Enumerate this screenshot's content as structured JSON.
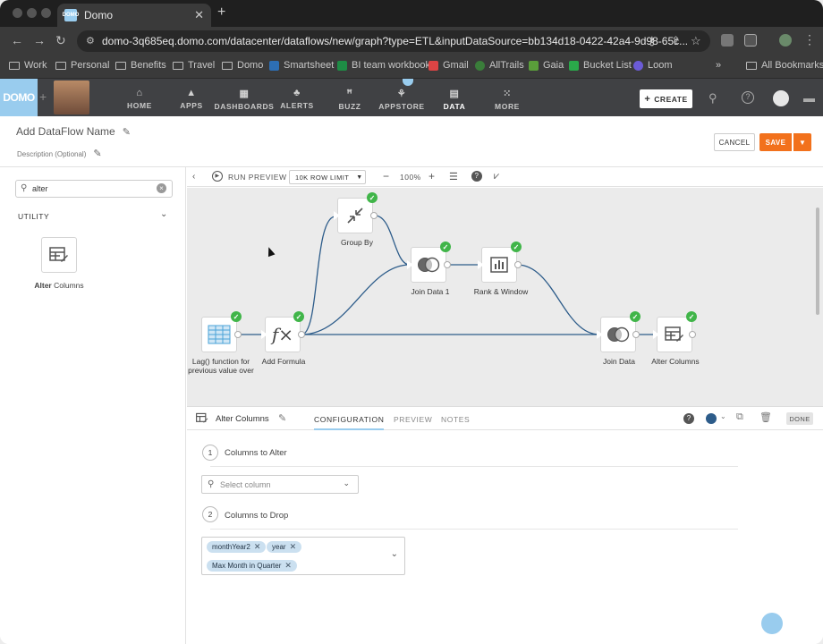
{
  "browser": {
    "tab_title": "Domo",
    "url": "domo-3q685eq.domo.com/datacenter/dataflows/new/graph?type=ETL&inputDataSource=bb134d18-0422-42a4-9d98-65c...",
    "bookmarks": [
      "Work",
      "Personal",
      "Benefits",
      "Travel",
      "Domo",
      "Smartsheet",
      "BI team workbook",
      "Gmail",
      "AllTrails",
      "Gaia",
      "Bucket List",
      "Loom"
    ],
    "all_bookmarks": "All Bookmarks",
    "favicon_text": "DOMO"
  },
  "topnav": {
    "logo": "DOMO",
    "items": [
      "HOME",
      "APPS",
      "DASHBOARDS",
      "ALERTS",
      "BUZZ",
      "APPSTORE",
      "DATA",
      "MORE"
    ],
    "create": "CREATE"
  },
  "header": {
    "dataflow_name": "Add DataFlow Name",
    "description": "Description (Optional)",
    "cancel": "CANCEL",
    "save": "SAVE"
  },
  "left": {
    "search_value": "alter",
    "section": "UTILITY",
    "tile_label_bold": "Alter",
    "tile_label_rest": " Columns"
  },
  "canvasbar": {
    "run_preview": "RUN PREVIEW",
    "row_limit": "10K ROW LIMIT",
    "zoom": "100%"
  },
  "nodes": {
    "lag": "Lag() function for previous value over",
    "add_formula": "Add Formula",
    "group_by": "Group By",
    "join1": "Join Data 1",
    "rank": "Rank & Window",
    "join": "Join Data",
    "alter": "Alter Columns"
  },
  "bottom": {
    "title": "Alter Columns",
    "tabs": [
      "CONFIGURATION",
      "PREVIEW",
      "NOTES"
    ],
    "done": "DONE",
    "step1_num": "1",
    "step1": "Columns to Alter",
    "select_placeholder": "Select column",
    "step2_num": "2",
    "step2": "Columns to Drop",
    "chips": [
      "monthYear2",
      "year",
      "Max Month in Quarter"
    ]
  },
  "colors": {
    "accent": "#99ccee",
    "save": "#f2711c",
    "check": "#40b549",
    "nav": "#404144"
  }
}
